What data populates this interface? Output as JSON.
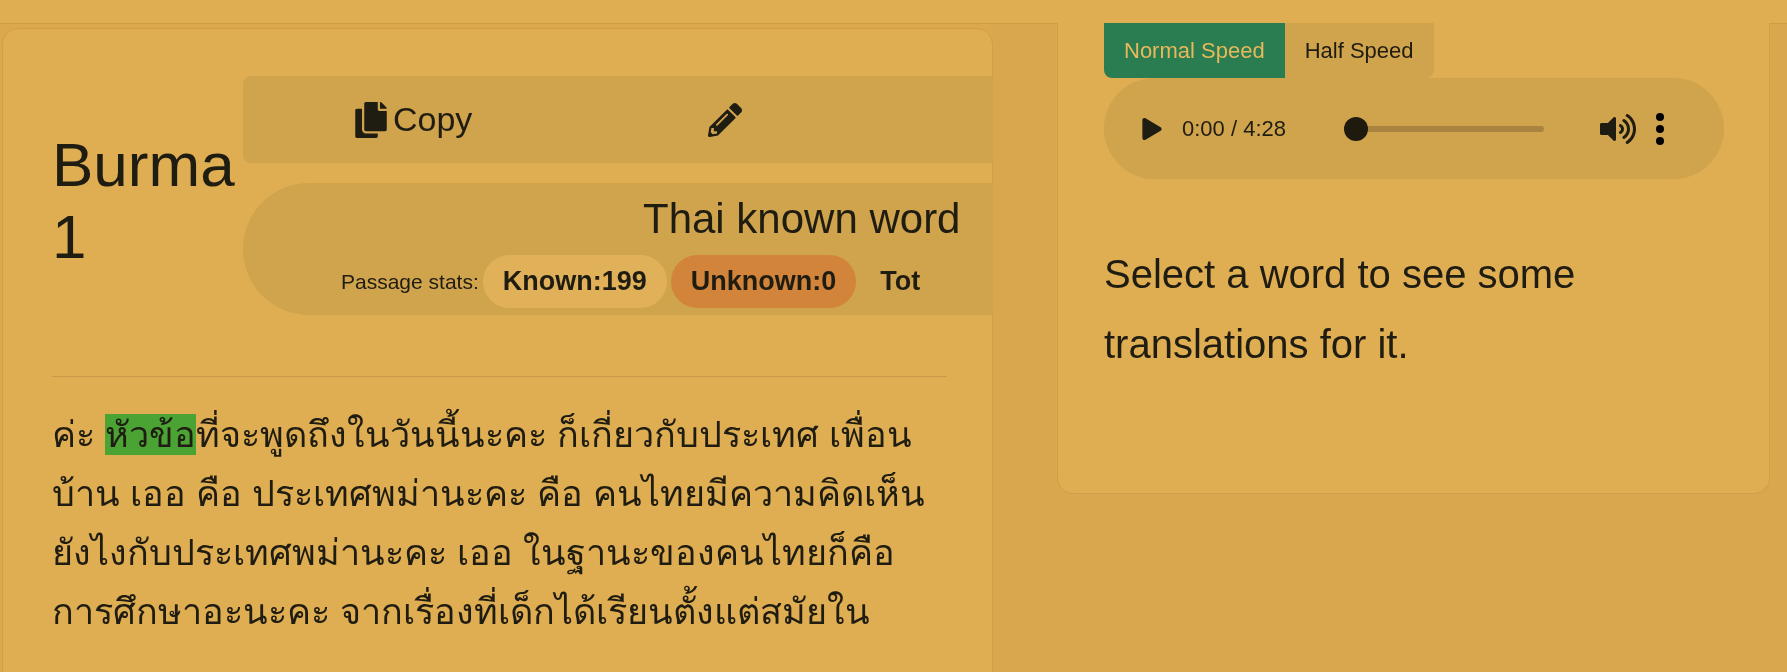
{
  "passage": {
    "title": "Burma 1",
    "paragraph": [
      {
        "text": "ค่ะ ",
        "highlighted": false
      },
      {
        "text": "หัวข้อ",
        "highlighted": true
      },
      {
        "text": "ที่จะพูดถึงในวันนี้นะคะ ก็เกี่ยวกับประเทศ เพื่อนบ้าน เออ คือ ประเทศพม่านะคะ คือ คนไทยมีความคิดเห็นยังไงกับประเทศพม่านะคะ เออ ในฐานะของคนไทยก็คือ การศึกษาอะนะคะ จากเรื่องที่เด็กได้เรียนตั้งแต่สมัยใน",
        "highlighted": false
      }
    ]
  },
  "toolbar": {
    "copy_label": "Copy"
  },
  "stats": {
    "heading": "Thai known word",
    "label": "Passage stats:",
    "chips": [
      {
        "text": "Known:199",
        "color": "#e0b158"
      },
      {
        "text": "Unknown:0",
        "color": "#d2843a"
      },
      {
        "text": "Tot"
      }
    ]
  },
  "speed_tabs": [
    {
      "label": "Normal Speed",
      "selected": true
    },
    {
      "label": "Half Speed",
      "selected": false
    }
  ],
  "audio": {
    "time": "0:00 / 4:28",
    "level": 0
  },
  "hint": "Select a word to see some translations for it."
}
